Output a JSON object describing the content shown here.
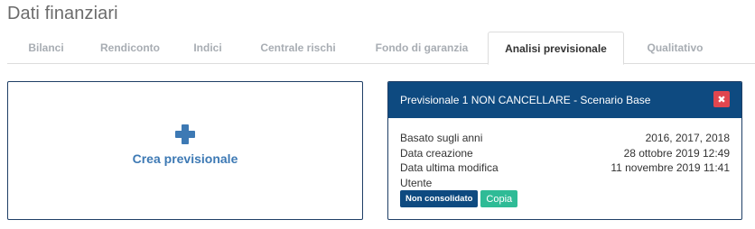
{
  "page": {
    "title": "Dati finanziari"
  },
  "tabs": [
    {
      "label": "Bilanci",
      "active": false
    },
    {
      "label": "Rendiconto",
      "active": false
    },
    {
      "label": "Indici",
      "active": false
    },
    {
      "label": "Centrale rischi",
      "active": false
    },
    {
      "label": "Fondo di garanzia",
      "active": false
    },
    {
      "label": "Analisi previsionale",
      "active": true
    },
    {
      "label": "Qualitativo",
      "active": false
    }
  ],
  "create_card": {
    "icon": "plus-icon",
    "label": "Crea previsionale"
  },
  "scenario": {
    "title": "Previsionale 1 NON CANCELLARE - Scenario Base",
    "close_icon": "close-icon",
    "rows": [
      {
        "label": "Basato sugli anni",
        "value": "2016, 2017, 2018"
      },
      {
        "label": "Data creazione",
        "value": "28 ottobre 2019 12:49"
      },
      {
        "label": "Data ultima modifica",
        "value": "11 novembre 2019 11:41"
      },
      {
        "label": "Utente",
        "value": ""
      }
    ],
    "badge_label": "Non consolidato",
    "copy_label": "Copia"
  },
  "colors": {
    "header_bg": "#0e4a80",
    "accent_blue": "#3d79b4",
    "close_red": "#e0464f",
    "copy_green": "#2fbb96"
  }
}
